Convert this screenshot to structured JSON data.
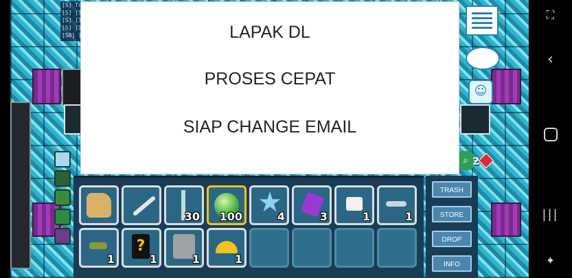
{
  "dialog": {
    "line1": "LAPAK DL",
    "line2": "PROSES CEPAT",
    "line3": "SIAP CHANGE EMAIL"
  },
  "chat": {
    "lines": [
      "[S] To",
      "[S] [1",
      "[S] [1",
      "[S] [1",
      "[SB] ["
    ]
  },
  "gems": {
    "count": "2"
  },
  "inventory": {
    "row1": [
      {
        "name": "fist-icon",
        "qty": ""
      },
      {
        "name": "wrench-icon",
        "qty": ""
      },
      {
        "name": "caduceus-icon",
        "qty": "30"
      },
      {
        "name": "green-orb-icon",
        "qty": "100"
      },
      {
        "name": "star-icon",
        "qty": "4"
      },
      {
        "name": "purple-crystal-icon",
        "qty": "3"
      },
      {
        "name": "shirt-icon",
        "qty": "1"
      },
      {
        "name": "wings-item-icon",
        "qty": "1"
      }
    ],
    "row2": [
      {
        "name": "sparkle-item-icon",
        "qty": "1"
      },
      {
        "name": "mystery-item-icon",
        "qty": "1"
      },
      {
        "name": "robot-head-icon",
        "qty": "1"
      },
      {
        "name": "hard-hat-icon",
        "qty": "1"
      }
    ]
  },
  "side_buttons": {
    "trash": "TRASH",
    "store": "STORE",
    "drop": "DROP",
    "info": "INFO"
  },
  "colors": {
    "selected_slot": "#f4c21d",
    "inventory_bg": "#1a3c55",
    "button_bg": "#4a86ad"
  }
}
